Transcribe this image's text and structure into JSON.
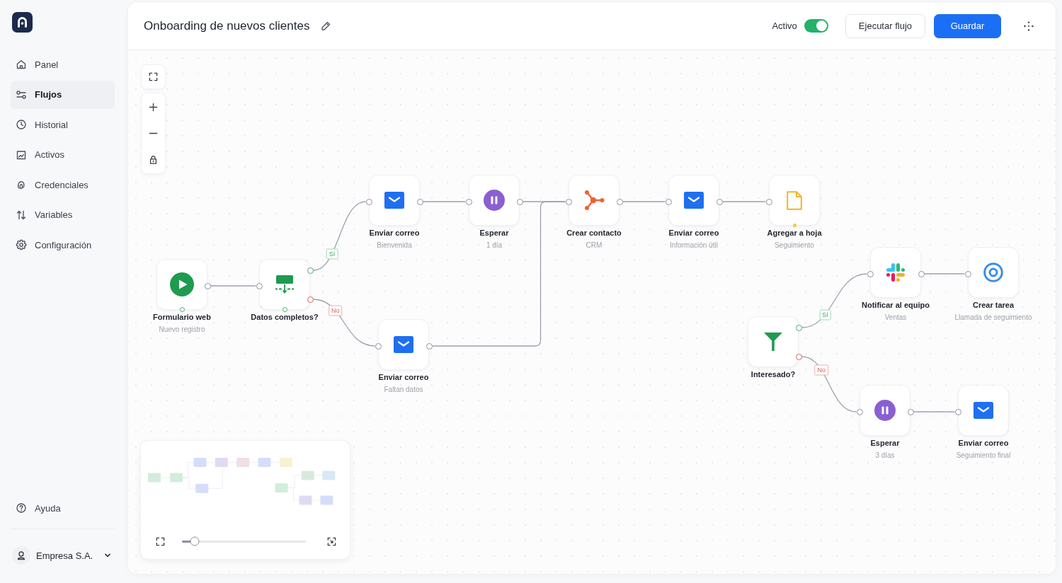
{
  "sidebar": {
    "items": [
      {
        "label": "Panel",
        "selected": false
      },
      {
        "label": "Flujos",
        "selected": true
      },
      {
        "label": "Historial",
        "selected": false
      },
      {
        "label": "Activos",
        "selected": false
      },
      {
        "label": "Credenciales",
        "selected": false
      },
      {
        "label": "Variables",
        "selected": false
      },
      {
        "label": "Configuración",
        "selected": false
      }
    ],
    "help": "Ayuda",
    "account": {
      "name": "Empresa S.A."
    }
  },
  "header": {
    "title": "Onboarding de nuevos clientes",
    "status": {
      "label": "Activo",
      "on": true
    },
    "buttons": [
      {
        "label": "Ejecutar flujo",
        "kind": "secondary"
      },
      {
        "label": "Guardar",
        "kind": "primary"
      }
    ]
  },
  "canvas": {
    "nodes": [
      {
        "kind": "trigger",
        "title": "Formulario web",
        "subtitle": "Nuevo registro"
      },
      {
        "kind": "condition",
        "title": "Datos completos?"
      },
      {
        "kind": "email",
        "title": "Enviar correo",
        "subtitle": "Bienvenida"
      },
      {
        "kind": "wait",
        "title": "Esperar",
        "subtitle": "1 día"
      },
      {
        "kind": "crm",
        "title": "Crear contacto",
        "subtitle": "CRM"
      },
      {
        "kind": "email",
        "title": "Enviar correo",
        "subtitle": "Información útil"
      },
      {
        "kind": "sheet",
        "title": "Agregar a hoja",
        "subtitle": "Seguimiento"
      },
      {
        "kind": "email",
        "title": "Enviar correo",
        "subtitle": "Faltan datos"
      },
      {
        "kind": "filter",
        "title": "Interesado?"
      },
      {
        "kind": "chat",
        "title": "Notificar al equipo",
        "subtitle": "Ventas"
      },
      {
        "kind": "task",
        "title": "Crear tarea",
        "subtitle": "Llamada de seguimiento"
      },
      {
        "kind": "wait",
        "title": "Esperar",
        "subtitle": "3 días"
      },
      {
        "kind": "email",
        "title": "Enviar correo",
        "subtitle": "Seguimiento final"
      }
    ],
    "edges": [
      {
        "kind": "plain"
      },
      {
        "kind": "yes",
        "label": "Sí"
      },
      {
        "kind": "no",
        "label": "No"
      },
      {
        "kind": "plain"
      },
      {
        "kind": "plain"
      },
      {
        "kind": "plain"
      },
      {
        "kind": "plain"
      },
      {
        "kind": "plain"
      },
      {
        "kind": "yes",
        "label": "Sí"
      },
      {
        "kind": "no",
        "label": "No"
      },
      {
        "kind": "plain"
      },
      {
        "kind": "plain"
      }
    ]
  },
  "minimap": {
    "zoom": {
      "level": 0.1
    }
  }
}
